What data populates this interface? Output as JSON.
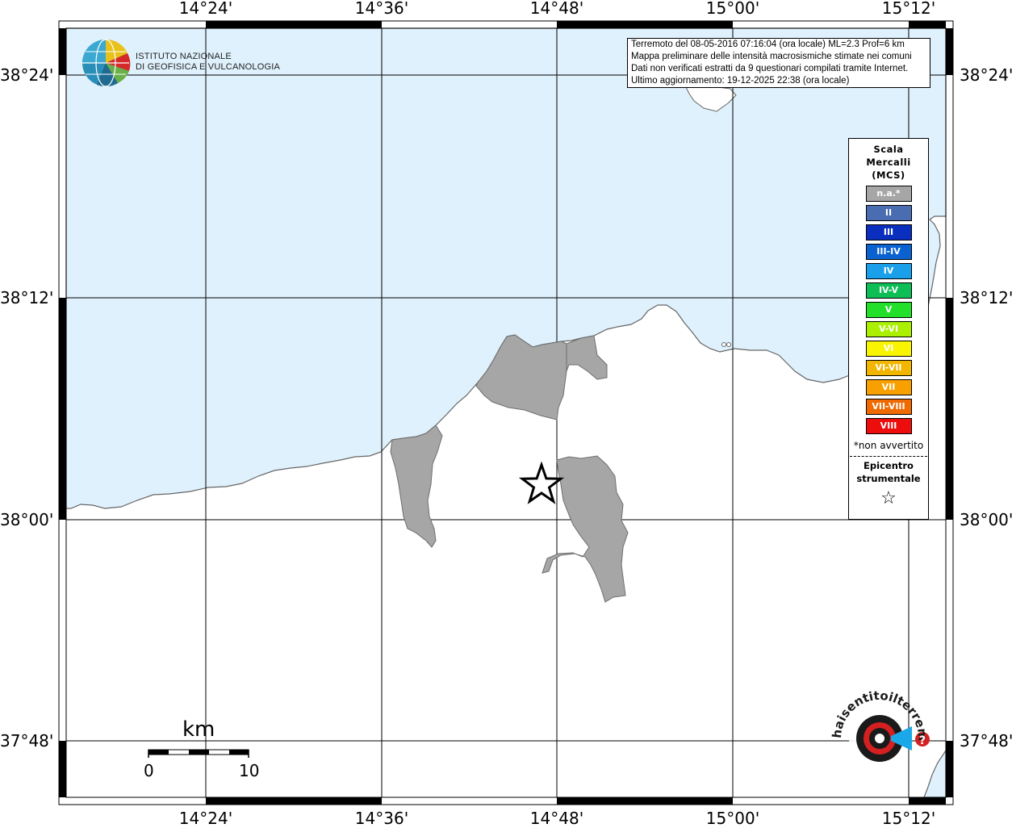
{
  "map": {
    "lon_ticks": [
      "14°24'",
      "14°36'",
      "14°48'",
      "15°00'",
      "15°12'"
    ],
    "lat_ticks": [
      "38°24'",
      "38°12'",
      "38°00'",
      "37°48'"
    ]
  },
  "info_box": {
    "lines": [
      "Terremoto del 08-05-2016 07:16:04 (ora locale) ML=2.3 Prof=6 km",
      "Mappa preliminare delle intensità macrosismiche stimate nei comuni",
      "Dati non verificati estratti da 9 questionari compilati tramite Internet.",
      "Ultimo aggiornamento: 19-12-2025 22:38 (ora locale)"
    ]
  },
  "logo": {
    "line1": "ISTITUTO NAZIONALE",
    "line2": "DI GEOFISICA E VULCANOLOGIA"
  },
  "legend": {
    "title_lines": [
      "Scala",
      "Mercalli",
      "(MCS)"
    ],
    "items": [
      {
        "label": "n.a.*",
        "color": "#a6a6a6"
      },
      {
        "label": "II",
        "color": "#4a6cb0"
      },
      {
        "label": "III",
        "color": "#0a2fbf"
      },
      {
        "label": "III-IV",
        "color": "#0a62d0"
      },
      {
        "label": "IV",
        "color": "#1a9fea"
      },
      {
        "label": "IV-V",
        "color": "#0dbd55"
      },
      {
        "label": "V",
        "color": "#22e02a"
      },
      {
        "label": "V-VI",
        "color": "#aaf000"
      },
      {
        "label": "VI",
        "color": "#f9f500"
      },
      {
        "label": "VI-VII",
        "color": "#f2b600"
      },
      {
        "label": "VII",
        "color": "#f8a000"
      },
      {
        "label": "VII-VIII",
        "color": "#ef6a00"
      },
      {
        "label": "VIII",
        "color": "#ee0d0d"
      }
    ],
    "note": "*non avvertito",
    "epicenter_lines": [
      "Epicentro",
      "strumentale"
    ],
    "epicenter_symbol": "☆"
  },
  "scale_bar": {
    "unit": "km",
    "start": "0",
    "end": "10"
  },
  "watermark": {
    "text": "haisentitoilterremoto.it www.",
    "question": "?"
  },
  "colors": {
    "sea": "#dff1fc",
    "land": "#ffffff",
    "felt_na": "#a6a6a6",
    "frame": "#000000"
  }
}
